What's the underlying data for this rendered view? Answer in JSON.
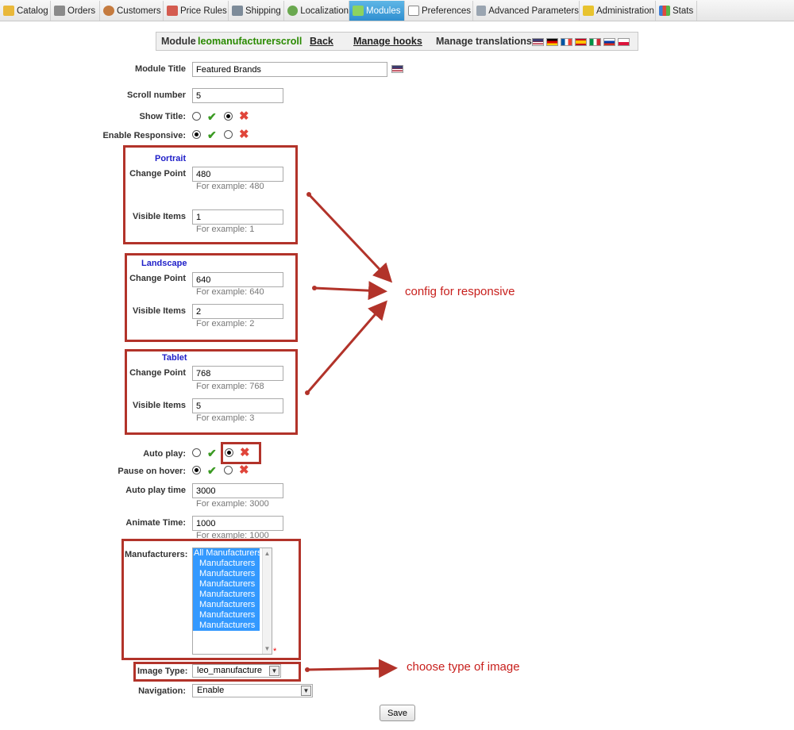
{
  "tabs": [
    {
      "label": "Catalog",
      "icon": "folder-icon"
    },
    {
      "label": "Orders",
      "icon": "cart-icon"
    },
    {
      "label": "Customers",
      "icon": "customers-icon"
    },
    {
      "label": "Price Rules",
      "icon": "price-rules-icon"
    },
    {
      "label": "Shipping",
      "icon": "truck-icon"
    },
    {
      "label": "Localization",
      "icon": "globe-icon"
    },
    {
      "label": "Modules",
      "icon": "puzzle-icon",
      "active": true
    },
    {
      "label": "Preferences",
      "icon": "preferences-icon"
    },
    {
      "label": "Advanced Parameters",
      "icon": "wrench-icon"
    },
    {
      "label": "Administration",
      "icon": "key-icon"
    },
    {
      "label": "Stats",
      "icon": "chart-icon"
    }
  ],
  "module_header": {
    "prefix": "Module",
    "module_name": "leomanufacturerscroll",
    "back": "Back",
    "manage_hooks": "Manage hooks",
    "manage_translations": "Manage translations",
    "flags": [
      "us-flag-icon",
      "de-flag-icon",
      "fr-flag-icon",
      "es-flag-icon",
      "it-flag-icon",
      "ru-flag-icon",
      "pl-flag-icon"
    ]
  },
  "form": {
    "module_title": {
      "label": "Module Title",
      "value": "Featured Brands"
    },
    "scroll_number": {
      "label": "Scroll number",
      "value": "5"
    },
    "show_title": {
      "label": "Show Title:",
      "value": "no"
    },
    "enable_responsive": {
      "label": "Enable Responsive:",
      "value": "yes"
    },
    "portrait": {
      "title": "Portrait",
      "change_point": {
        "label": "Change Point",
        "value": "480",
        "hint": "For example: 480"
      },
      "visible_items": {
        "label": "Visible Items",
        "value": "1",
        "hint": "For example: 1"
      }
    },
    "landscape": {
      "title": "Landscape",
      "change_point": {
        "label": "Change Point",
        "value": "640",
        "hint": "For example: 640"
      },
      "visible_items": {
        "label": "Visible Items",
        "value": "2",
        "hint": "For example: 2"
      }
    },
    "tablet": {
      "title": "Tablet",
      "change_point": {
        "label": "Change Point",
        "value": "768",
        "hint": "For example: 768"
      },
      "visible_items": {
        "label": "Visible Items",
        "value": "5",
        "hint": "For example: 3"
      }
    },
    "auto_play": {
      "label": "Auto play:",
      "value": "no"
    },
    "pause_on_hover": {
      "label": "Pause on hover:",
      "value": "yes"
    },
    "auto_play_time": {
      "label": "Auto play time",
      "value": "3000",
      "hint": "For example: 3000"
    },
    "animate_time": {
      "label": "Animate Time:",
      "value": "1000",
      "hint": "For example: 1000"
    },
    "manufacturers": {
      "label": "Manufacturers:",
      "options": [
        "All Manufacturers",
        "Manufacturers",
        "Manufacturers",
        "Manufacturers",
        "Manufacturers",
        "Manufacturers",
        "Manufacturers",
        "Manufacturers"
      ],
      "required_mark": "*"
    },
    "image_type": {
      "label": "Image Type:",
      "value": "leo_manufacture"
    },
    "navigation": {
      "label": "Navigation:",
      "value": "Enable"
    },
    "save": "Save"
  },
  "annotations": {
    "responsive_note": "config for responsive",
    "image_note": "choose type of image",
    "color": "#b2332a"
  },
  "colors": {
    "active_tab": "#2f8fd0",
    "module_name": "#2a8a00",
    "section_title": "#1f1fc8",
    "check": "#3a9a22",
    "cross": "#e0453a",
    "selected_option": "#3399ff"
  }
}
